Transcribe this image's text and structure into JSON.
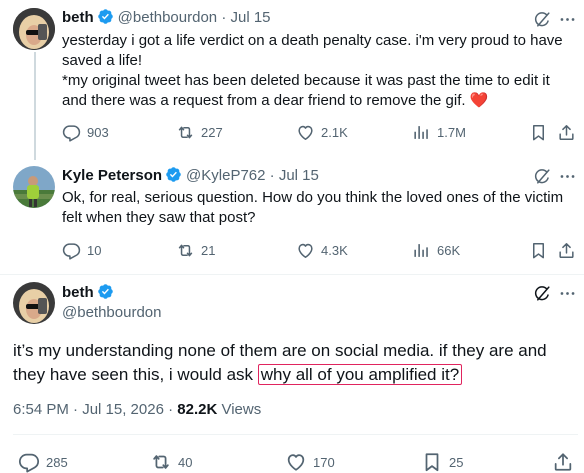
{
  "tweet1": {
    "name": "beth",
    "handle": "@bethbourdon",
    "dot": "·",
    "date": "Jul 15",
    "text_line1": "yesterday i got a life verdict on a death penalty case. i'm very proud to have saved a life!",
    "text_line2": "*my original tweet has been deleted because it was past the time to edit it and there was a request from a dear friend to remove the gif.",
    "emoji": "❤️",
    "replies": "903",
    "retweets": "227",
    "likes": "2.1K",
    "views": "1.7M"
  },
  "tweet2": {
    "name": "Kyle Peterson",
    "handle": "@KyleP762",
    "dot": "·",
    "date": "Jul 15",
    "text": "Ok, for real, serious question.  How do you think the loved ones of the victim felt when they saw that post?",
    "replies": "10",
    "retweets": "21",
    "likes": "4.3K",
    "views": "66K"
  },
  "tweet3": {
    "name": "beth",
    "handle": "@bethbourdon",
    "text_main": "it’s my understanding none of them are on social media. if they are and they have seen this, i would ask ",
    "text_highlight": "why all of you amplified it?",
    "timestamp": "6:54 PM · Jul 15, 2026 · ",
    "views_count": "82.2K",
    "views_label": " Views",
    "replies": "285",
    "retweets": "40",
    "likes": "170",
    "bookmarks": "25"
  },
  "colors": {
    "accent": "#1d9bf0",
    "text": "#0f1419",
    "secondary": "#536471",
    "highlight_border": "#e0245e"
  },
  "icons": [
    "grok-icon",
    "more-icon",
    "reply-icon",
    "retweet-icon",
    "like-icon",
    "views-icon",
    "bookmark-icon",
    "share-icon",
    "verified-icon"
  ]
}
